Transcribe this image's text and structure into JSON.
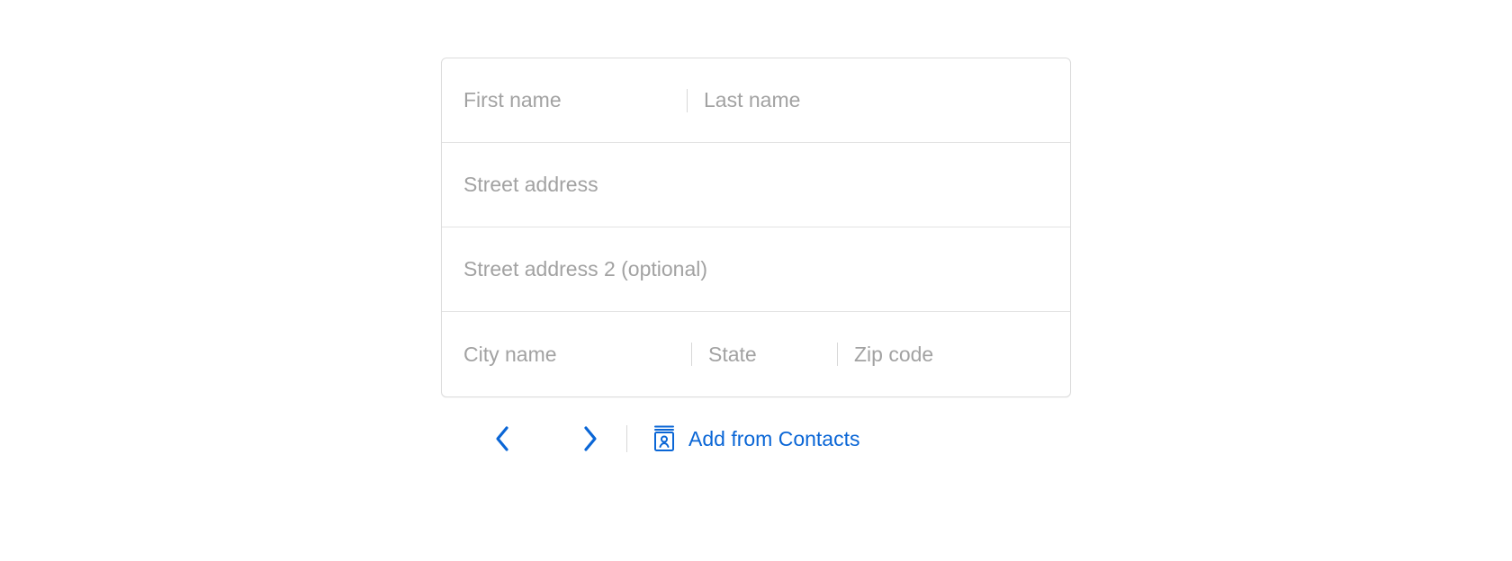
{
  "form": {
    "first_name": {
      "placeholder": "First name",
      "value": ""
    },
    "last_name": {
      "placeholder": "Last name",
      "value": ""
    },
    "street1": {
      "placeholder": "Street address",
      "value": ""
    },
    "street2": {
      "placeholder": "Street address 2 (optional)",
      "value": ""
    },
    "city": {
      "placeholder": "City name",
      "value": ""
    },
    "state": {
      "placeholder": "State",
      "value": ""
    },
    "zip": {
      "placeholder": "Zip code",
      "value": ""
    }
  },
  "toolbar": {
    "add_from_contacts_label": "Add from Contacts"
  }
}
